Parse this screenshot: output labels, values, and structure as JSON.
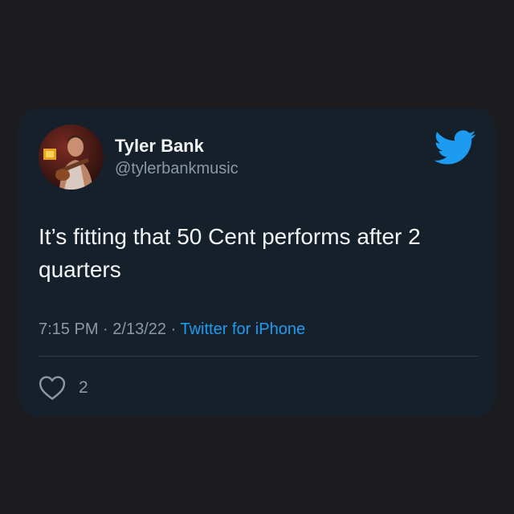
{
  "tweet": {
    "author": {
      "display_name": "Tyler Bank",
      "handle": "@tylerbankmusic",
      "avatar_icon": "person-with-guitar-photo"
    },
    "text": "It’s fitting that 50 Cent performs after 2 quarters",
    "time": "7:15 PM",
    "separator": "·",
    "date": "2/13/22",
    "source": "Twitter for iPhone",
    "like_count": "2",
    "like_icon": "heart-icon",
    "brand_icon": "twitter-bird-icon"
  },
  "colors": {
    "background": "#1c1c1e",
    "card": "#16202b",
    "text_primary": "#f2f4f5",
    "text_secondary": "#8b98a5",
    "accent": "#1d9bf0"
  }
}
